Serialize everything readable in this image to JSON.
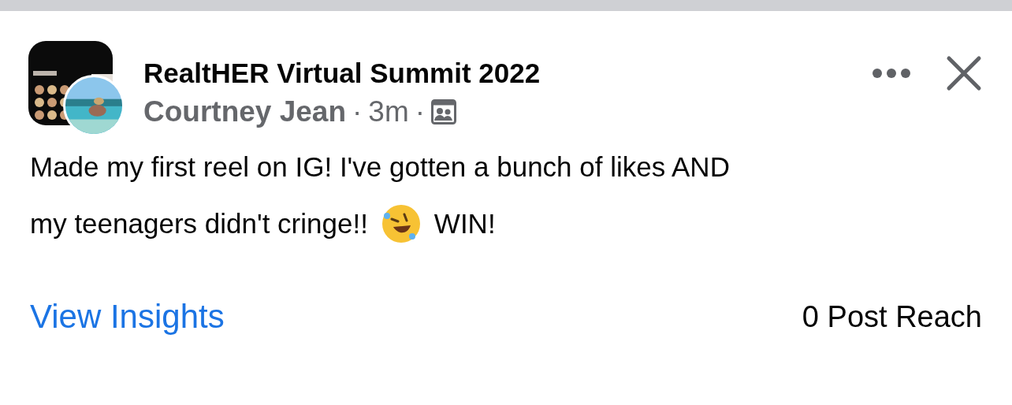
{
  "post": {
    "group": "RealtHER Virtual Summit 2022",
    "author": "Courtney Jean",
    "separator_1": "·",
    "time": "3m",
    "separator_2": "·",
    "text": "Made my first reel on IG! I've gotten a bunch of likes AND",
    "text_line_2": "my teenagers didn't cringe!!",
    "text_after_emoji": "WIN!"
  },
  "footer": {
    "link": "View Insights",
    "reach": "0 Post Reach"
  }
}
